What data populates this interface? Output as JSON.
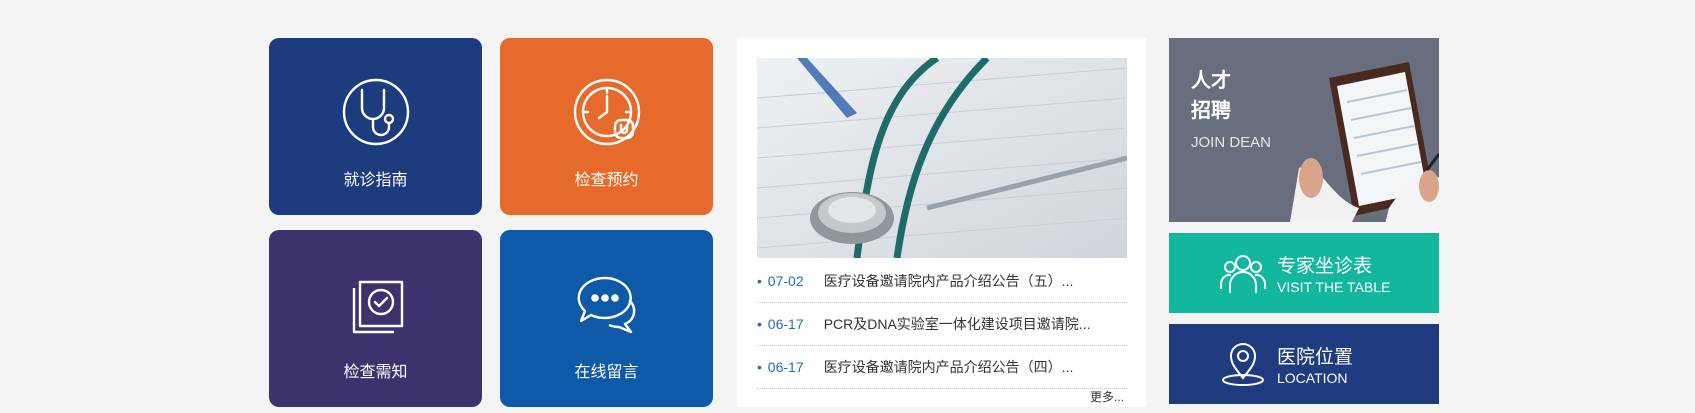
{
  "tiles": [
    {
      "label": "就诊指南",
      "icon": "stethoscope-icon",
      "color": "#1d3c7e"
    },
    {
      "label": "检查预约",
      "icon": "clock-stethoscope-icon",
      "color": "#e66a2b"
    },
    {
      "label": "检查需知",
      "icon": "document-check-icon",
      "color": "#3e326e"
    },
    {
      "label": "在线留言",
      "icon": "chat-bubbles-icon",
      "color": "#0e5aa9"
    }
  ],
  "news": {
    "items": [
      {
        "date": "07-02",
        "title": "医疗设备邀请院内产品介绍公告（五）..."
      },
      {
        "date": "06-17",
        "title": "PCR及DNA实验室一体化建设项目邀请院..."
      },
      {
        "date": "06-17",
        "title": "医疗设备邀请院内产品介绍公告（四）..."
      }
    ],
    "more": "更多..."
  },
  "join": {
    "line1": "人才",
    "line2": "招聘",
    "sub": "JOIN DEAN"
  },
  "schedule": {
    "zh": "专家坐诊表",
    "en": "VISIT THE TABLE",
    "icon": "people-icon",
    "color": "#12b79e"
  },
  "location": {
    "zh": "医院位置",
    "en": "LOCATION",
    "icon": "map-pin-icon",
    "color": "#1f3c80"
  }
}
